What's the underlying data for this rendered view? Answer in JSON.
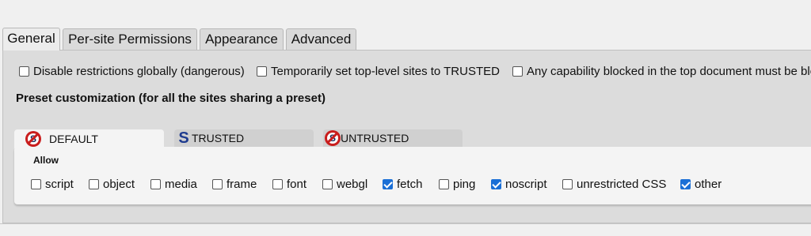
{
  "tabs": [
    {
      "label": "General",
      "active": true
    },
    {
      "label": "Per-site Permissions",
      "active": false
    },
    {
      "label": "Appearance",
      "active": false
    },
    {
      "label": "Advanced",
      "active": false
    }
  ],
  "options": [
    {
      "label": "Disable restrictions globally (dangerous)",
      "checked": false
    },
    {
      "label": "Temporarily set top-level sites to TRUSTED",
      "checked": false
    },
    {
      "label": "Any capability blocked in the top document must be blo",
      "checked": false
    }
  ],
  "preset_title": "Preset customization (for all the sites sharing a preset)",
  "presets": [
    {
      "label": "DEFAULT",
      "icon": "noscript-ban-icon",
      "active": true
    },
    {
      "label": "TRUSTED",
      "icon": "noscript-s-icon",
      "active": false
    },
    {
      "label": "UNTRUSTED",
      "icon": "noscript-ban-icon",
      "active": false
    }
  ],
  "allow_label": "Allow",
  "permissions": [
    {
      "label": "script",
      "checked": false
    },
    {
      "label": "object",
      "checked": false
    },
    {
      "label": "media",
      "checked": false
    },
    {
      "label": "frame",
      "checked": false
    },
    {
      "label": "font",
      "checked": false
    },
    {
      "label": "webgl",
      "checked": false
    },
    {
      "label": "fetch",
      "checked": true
    },
    {
      "label": "ping",
      "checked": false
    },
    {
      "label": "noscript",
      "checked": true
    },
    {
      "label": "unrestricted CSS",
      "checked": false
    },
    {
      "label": "other",
      "checked": true
    }
  ],
  "colors": {
    "accent": "#1a6fd6",
    "ban_red": "#c91d1d",
    "s_blue": "#1e3b8f"
  }
}
